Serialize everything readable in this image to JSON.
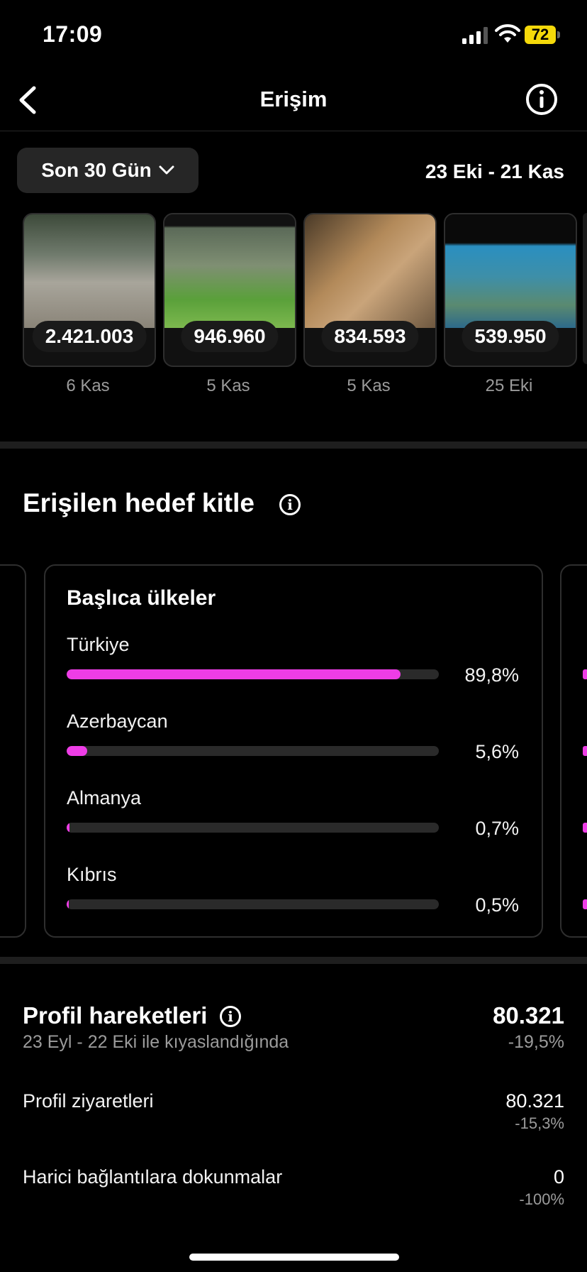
{
  "status": {
    "time": "17:09",
    "battery": "72"
  },
  "nav": {
    "title": "Erişim"
  },
  "filter": {
    "range_label": "Son 30 Gün",
    "date_range": "23 Eki - 21 Kas"
  },
  "content": [
    {
      "value": "2.421.003",
      "date": "6 Kas"
    },
    {
      "value": "946.960",
      "date": "5 Kas"
    },
    {
      "value": "834.593",
      "date": "5 Kas"
    },
    {
      "value": "539.950",
      "date": "25 Eki"
    }
  ],
  "audience": {
    "title": "Erişilen hedef kitle",
    "card": {
      "title": "Başlıca ülkeler",
      "countries": [
        {
          "name": "Türkiye",
          "pct": "89,8%",
          "value": 89.8
        },
        {
          "name": "Azerbaycan",
          "pct": "5,6%",
          "value": 5.6
        },
        {
          "name": "Almanya",
          "pct": "0,7%",
          "value": 0.7
        },
        {
          "name": "Kıbrıs",
          "pct": "0,5%",
          "value": 0.5
        }
      ]
    }
  },
  "profile": {
    "title": "Profil hareketleri",
    "compare": "23 Eyl - 22 Eki ile kıyaslandığında",
    "total": "80.321",
    "total_change": "-19,5%",
    "rows": [
      {
        "label": "Profil ziyaretleri",
        "value": "80.321",
        "change": "-15,3%"
      },
      {
        "label": "Harici bağlantılara dokunmalar",
        "value": "0",
        "change": "-100%"
      }
    ]
  },
  "colors": {
    "accent": "#ee3de6",
    "background": "#000000",
    "battery": "#f5d90a"
  }
}
